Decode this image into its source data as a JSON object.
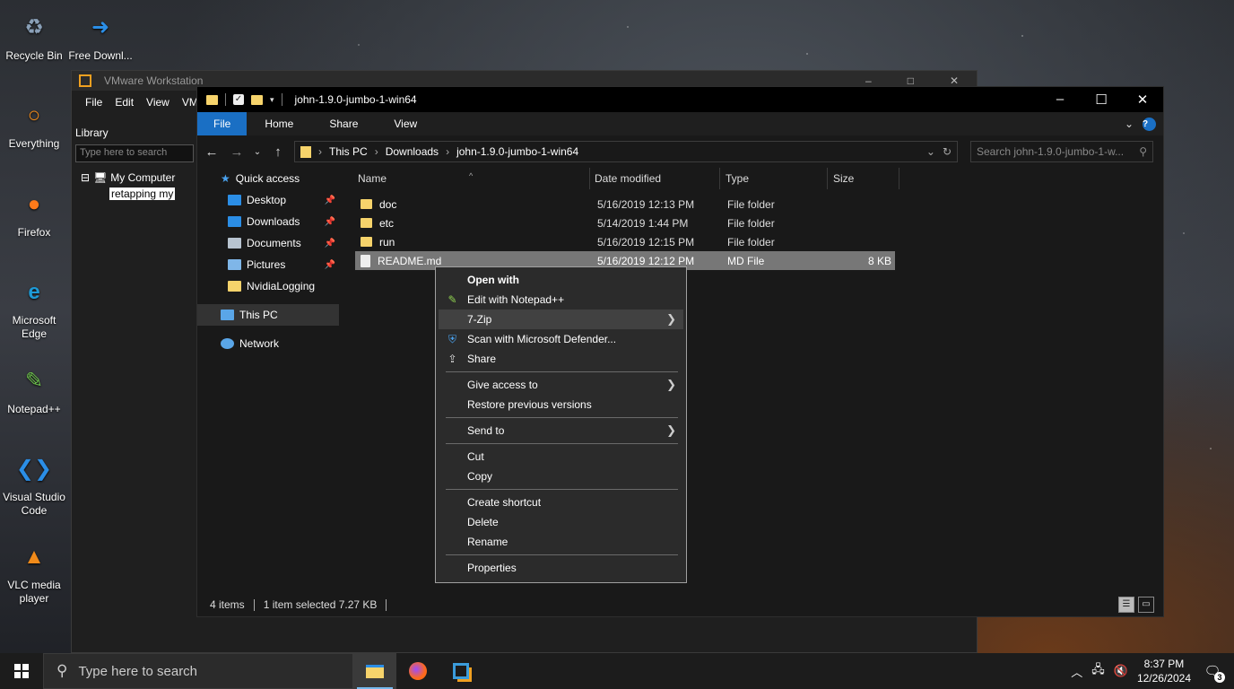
{
  "desktop": {
    "icons": [
      {
        "label": "Recycle Bin",
        "glyph": "♻"
      },
      {
        "label": "Free Downl...",
        "glyph": "➜"
      },
      {
        "label": "Everything",
        "glyph": "○"
      },
      {
        "label": "Firefox",
        "glyph": "●"
      },
      {
        "label": "Microsoft Edge",
        "glyph": "e"
      },
      {
        "label": "Notepad++",
        "glyph": "✎"
      },
      {
        "label": "Visual Studio Code",
        "glyph": "❮❯"
      },
      {
        "label": "VLC media player",
        "glyph": "▲"
      }
    ]
  },
  "vmware": {
    "title": "VMware Workstation",
    "menu": [
      "File",
      "Edit",
      "View",
      "VM"
    ],
    "library_label": "Library",
    "search_placeholder": "Type here to search",
    "tree_root": "My Computer",
    "tree_child": "retapping my"
  },
  "explorer": {
    "title": "john-1.9.0-jumbo-1-win64",
    "ribbon_tabs": [
      "File",
      "Home",
      "Share",
      "View"
    ],
    "breadcrumb": [
      "This PC",
      "Downloads",
      "john-1.9.0-jumbo-1-win64"
    ],
    "search_placeholder": "Search john-1.9.0-jumbo-1-w...",
    "nav": {
      "quick_access": "Quick access",
      "items": [
        {
          "label": "Desktop",
          "pinned": true,
          "color": "#2b8ee6"
        },
        {
          "label": "Downloads",
          "pinned": true,
          "color": "#2b8ee6"
        },
        {
          "label": "Documents",
          "pinned": true,
          "color": "#b8c4d0"
        },
        {
          "label": "Pictures",
          "pinned": true,
          "color": "#7fb6e8"
        },
        {
          "label": "NvidiaLogging",
          "pinned": false,
          "color": "#f6d36b"
        }
      ],
      "this_pc": "This PC",
      "network": "Network"
    },
    "columns": [
      "Name",
      "Date modified",
      "Type",
      "Size"
    ],
    "files": [
      {
        "name": "doc",
        "date": "5/16/2019 12:13 PM",
        "type": "File folder",
        "size": "",
        "kind": "folder"
      },
      {
        "name": "etc",
        "date": "5/14/2019 1:44 PM",
        "type": "File folder",
        "size": "",
        "kind": "folder"
      },
      {
        "name": "run",
        "date": "5/16/2019 12:15 PM",
        "type": "File folder",
        "size": "",
        "kind": "folder"
      },
      {
        "name": "README.md",
        "date": "5/16/2019 12:12 PM",
        "type": "MD File",
        "size": "8 KB",
        "kind": "file"
      }
    ],
    "status": {
      "items": "4 items",
      "selected": "1 item selected  7.27 KB"
    }
  },
  "context_menu": {
    "groups": [
      [
        {
          "label": "Open with",
          "bold": true,
          "icon": "",
          "submenu": false
        },
        {
          "label": "Edit with Notepad++",
          "icon": "notepad-icon",
          "submenu": false
        },
        {
          "label": "7-Zip",
          "icon": "",
          "submenu": true,
          "highlighted": true
        },
        {
          "label": "Scan with Microsoft Defender...",
          "icon": "defender-icon",
          "submenu": false
        },
        {
          "label": "Share",
          "icon": "share-icon",
          "submenu": false
        }
      ],
      [
        {
          "label": "Give access to",
          "icon": "",
          "submenu": true
        },
        {
          "label": "Restore previous versions",
          "icon": "",
          "submenu": false
        }
      ],
      [
        {
          "label": "Send to",
          "icon": "",
          "submenu": true
        }
      ],
      [
        {
          "label": "Cut",
          "icon": "",
          "submenu": false
        },
        {
          "label": "Copy",
          "icon": "",
          "submenu": false
        }
      ],
      [
        {
          "label": "Create shortcut",
          "icon": "",
          "submenu": false
        },
        {
          "label": "Delete",
          "icon": "",
          "submenu": false
        },
        {
          "label": "Rename",
          "icon": "",
          "submenu": false
        }
      ],
      [
        {
          "label": "Properties",
          "icon": "",
          "submenu": false
        }
      ]
    ]
  },
  "taskbar": {
    "search_placeholder": "Type here to search",
    "time": "8:37 PM",
    "date": "12/26/2024",
    "notification_count": "3"
  }
}
